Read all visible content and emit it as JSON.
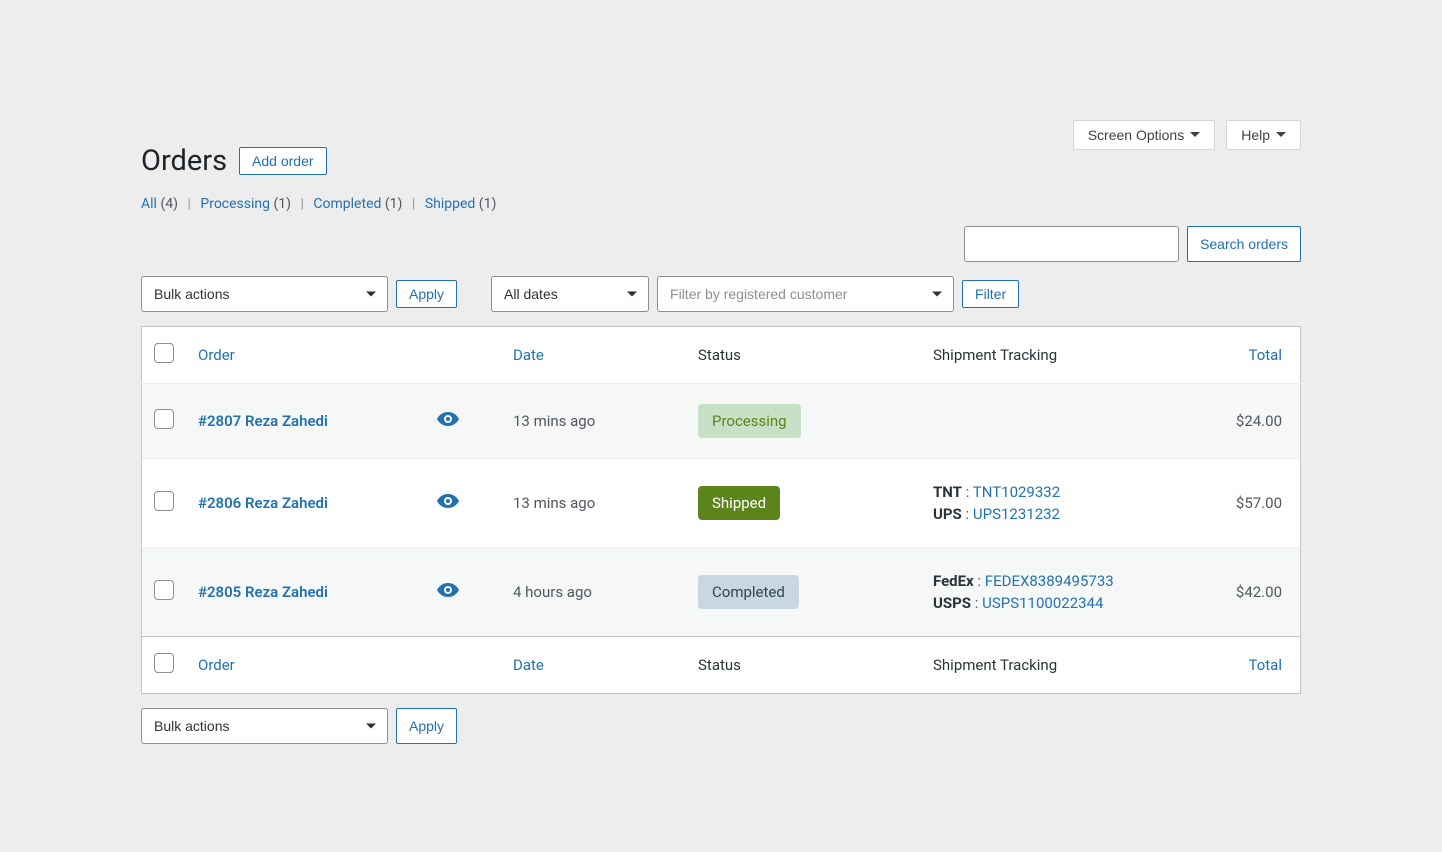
{
  "topButtons": {
    "screenOptions": "Screen Options",
    "help": "Help"
  },
  "pageTitle": "Orders",
  "addOrder": "Add order",
  "filters": {
    "links": [
      {
        "label": "All",
        "count": "(4)"
      },
      {
        "label": "Processing",
        "count": "(1)"
      },
      {
        "label": "Completed",
        "count": "(1)"
      },
      {
        "label": "Shipped",
        "count": "(1)"
      }
    ]
  },
  "search": {
    "button": "Search orders"
  },
  "controls": {
    "bulkActions": "Bulk actions",
    "apply": "Apply",
    "allDates": "All dates",
    "customerFilter": "Filter by registered customer",
    "filter": "Filter"
  },
  "columns": {
    "order": "Order",
    "date": "Date",
    "status": "Status",
    "shipment": "Shipment Tracking",
    "total": "Total"
  },
  "rows": [
    {
      "order": "#2807 Reza Zahedi",
      "date": "13 mins ago",
      "status": "Processing",
      "statusClass": "status-processing",
      "tracking": [],
      "total": "$24.00"
    },
    {
      "order": "#2806 Reza Zahedi",
      "date": "13 mins ago",
      "status": "Shipped",
      "statusClass": "status-shipped",
      "tracking": [
        {
          "carrier": "TNT",
          "code": "TNT1029332"
        },
        {
          "carrier": "UPS",
          "code": "UPS1231232"
        }
      ],
      "total": "$57.00"
    },
    {
      "order": "#2805 Reza Zahedi",
      "date": "4 hours ago",
      "status": "Completed",
      "statusClass": "status-completed",
      "tracking": [
        {
          "carrier": "FedEx",
          "code": "FEDEX8389495733"
        },
        {
          "carrier": "USPS",
          "code": "USPS1100022344"
        }
      ],
      "total": "$42.00"
    }
  ]
}
